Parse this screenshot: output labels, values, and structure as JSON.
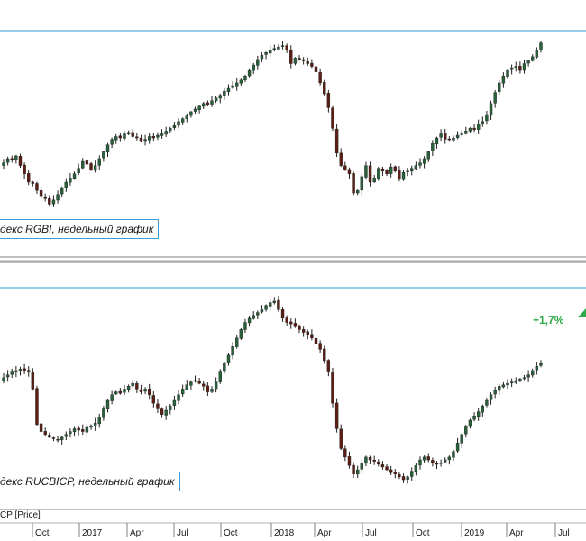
{
  "chart_data": [
    {
      "type": "candlestick",
      "caption": "декс RGBI, недельный график",
      "data_start": "2016-08-22",
      "interval": "weekly",
      "resistance_level_line": true,
      "colors": {
        "up": "#28623a",
        "down": "#5c1e14",
        "level_line": "#3a9ad9"
      },
      "x_ticks": [
        "Oct",
        "2017",
        "Apr",
        "Jul",
        "Oct",
        "2018",
        "Apr",
        "Jul",
        "Oct",
        "2019",
        "Apr",
        "Jul"
      ],
      "closes": [
        1.1,
        1.13,
        1.12,
        1.15,
        1.08,
        1.02,
        0.96,
        0.95,
        0.9,
        0.86,
        0.84,
        0.8,
        0.83,
        0.87,
        0.92,
        0.96,
        0.99,
        1.02,
        1.06,
        1.11,
        1.09,
        1.05,
        1.08,
        1.13,
        1.18,
        1.23,
        1.27,
        1.29,
        1.28,
        1.31,
        1.32,
        1.29,
        1.28,
        1.26,
        1.27,
        1.29,
        1.28,
        1.3,
        1.31,
        1.33,
        1.35,
        1.37,
        1.4,
        1.42,
        1.44,
        1.47,
        1.49,
        1.51,
        1.53,
        1.52,
        1.55,
        1.57,
        1.59,
        1.62,
        1.64,
        1.66,
        1.68,
        1.7,
        1.73,
        1.77,
        1.81,
        1.85,
        1.88,
        1.9,
        1.92,
        1.93,
        1.94,
        1.95,
        1.92,
        1.82,
        1.86,
        1.85,
        1.84,
        1.82,
        1.8,
        1.76,
        1.68,
        1.6,
        1.5,
        1.35,
        1.17,
        1.08,
        1.05,
        1.02,
        0.88,
        0.9,
        1.0,
        1.08,
        0.96,
        0.99,
        1.06,
        1.04,
        1.02,
        1.07,
        1.04,
        0.98,
        1.03,
        1.04,
        1.06,
        1.08,
        1.1,
        1.13,
        1.18,
        1.24,
        1.28,
        1.31,
        1.27,
        1.27,
        1.28,
        1.3,
        1.31,
        1.33,
        1.35,
        1.34,
        1.38,
        1.4,
        1.45,
        1.53,
        1.61,
        1.68,
        1.73,
        1.77,
        1.79,
        1.8,
        1.77,
        1.82,
        1.84,
        1.87,
        1.92,
        1.97
      ]
    },
    {
      "type": "candlestick",
      "caption": "декс RUCBICP, недельный график",
      "data_start": "2016-08-22",
      "interval": "weekly",
      "resistance_level_line": true,
      "series_tag": "CP [Price]",
      "annotation": "+1,7%",
      "colors": {
        "up": "#28623a",
        "down": "#5c1e14",
        "level_line": "#3a9ad9",
        "annotation": "#2ea84a"
      },
      "x_ticks": [
        "Oct",
        "2017",
        "Apr",
        "Jul",
        "Oct",
        "2018",
        "Apr",
        "Jul",
        "Oct",
        "2019",
        "Apr",
        "Jul"
      ],
      "closes": [
        1.28,
        1.3,
        1.32,
        1.33,
        1.34,
        1.33,
        1.32,
        1.2,
        0.95,
        0.9,
        0.88,
        0.86,
        0.85,
        0.84,
        0.86,
        0.88,
        0.9,
        0.92,
        0.91,
        0.9,
        0.93,
        0.94,
        0.96,
        1.0,
        1.06,
        1.12,
        1.16,
        1.18,
        1.17,
        1.2,
        1.22,
        1.24,
        1.2,
        1.18,
        1.2,
        1.16,
        1.1,
        1.06,
        1.02,
        1.05,
        1.08,
        1.12,
        1.16,
        1.2,
        1.23,
        1.25,
        1.26,
        1.24,
        1.22,
        1.18,
        1.2,
        1.25,
        1.32,
        1.38,
        1.44,
        1.5,
        1.56,
        1.62,
        1.67,
        1.7,
        1.72,
        1.74,
        1.76,
        1.79,
        1.81,
        1.82,
        1.76,
        1.7,
        1.67,
        1.66,
        1.64,
        1.62,
        1.6,
        1.58,
        1.56,
        1.52,
        1.48,
        1.4,
        1.32,
        1.1,
        0.92,
        0.78,
        0.72,
        0.66,
        0.6,
        0.63,
        0.68,
        0.72,
        0.7,
        0.69,
        0.67,
        0.65,
        0.63,
        0.61,
        0.6,
        0.58,
        0.56,
        0.58,
        0.62,
        0.66,
        0.7,
        0.72,
        0.7,
        0.68,
        0.67,
        0.68,
        0.7,
        0.72,
        0.76,
        0.82,
        0.88,
        0.94,
        0.98,
        1.01,
        1.04,
        1.08,
        1.12,
        1.16,
        1.19,
        1.22,
        1.23,
        1.24,
        1.25,
        1.26,
        1.27,
        1.28,
        1.3,
        1.33,
        1.36,
        1.38
      ]
    }
  ]
}
